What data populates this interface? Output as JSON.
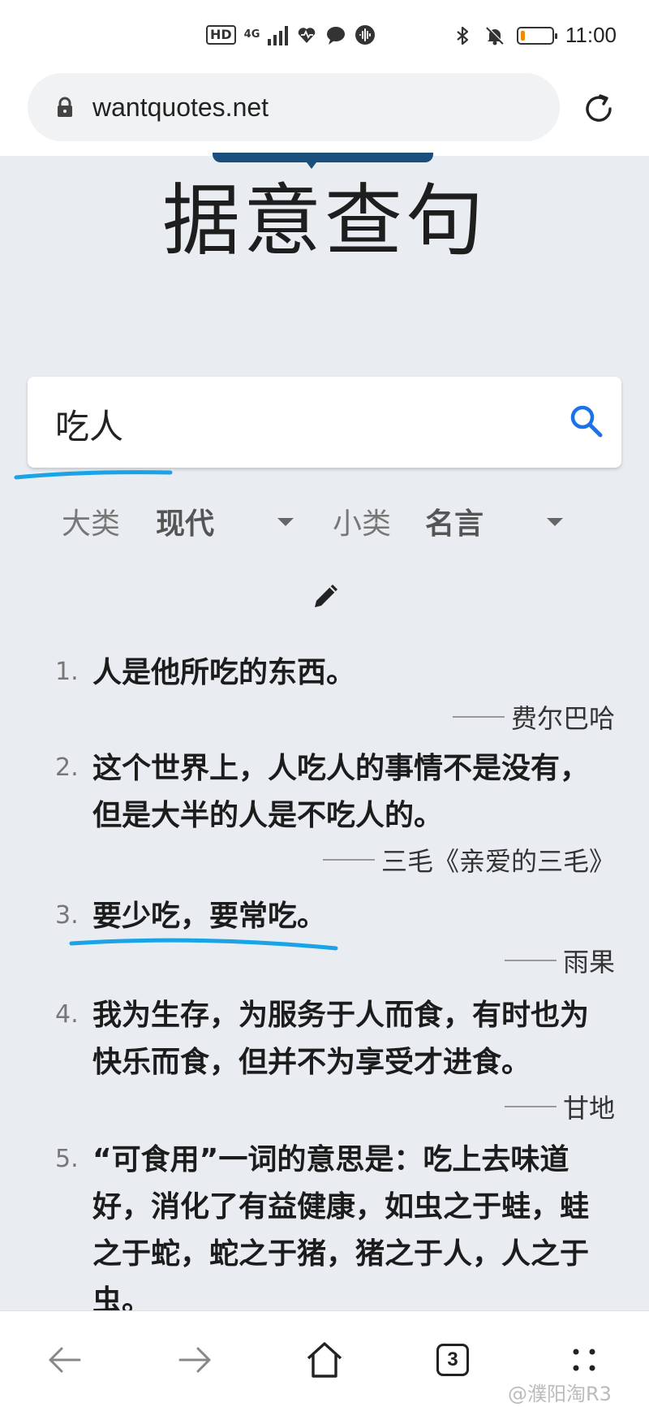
{
  "status_bar": {
    "hd": "HD",
    "network": "4G",
    "time": "11:00",
    "battery_level_percent": 15,
    "battery_color": "#f08a00"
  },
  "browser": {
    "url": "wantquotes.net",
    "open_tabs": "3"
  },
  "page": {
    "title": "据意查句",
    "search": {
      "value": "吃人"
    },
    "filters": {
      "major_label": "大类",
      "major_value": "现代",
      "minor_label": "小类",
      "minor_value": "名言"
    },
    "quotes": [
      {
        "num": "1.",
        "lines": [
          "人是他所吃的东西。"
        ],
        "source": "费尔巴哈"
      },
      {
        "num": "2.",
        "lines": [
          "这个世界上，人吃人的事情不是没有，",
          "但是大半的人是不吃人的。"
        ],
        "source": "三毛《亲爱的三毛》"
      },
      {
        "num": "3.",
        "lines": [
          "要少吃，要常吃。"
        ],
        "source": "雨果"
      },
      {
        "num": "4.",
        "lines": [
          "我为生存，为服务于人而食，有时也为",
          "快乐而食，但并不为享受才进食。"
        ],
        "source": "甘地"
      },
      {
        "num": "5.",
        "lines": [
          "“可食用”一词的意思是：吃上去味道",
          "好，消化了有益健康，如虫之于蛙，蛙",
          "之于蛇，蛇之于猪，猪之于人，人之于",
          "虫。"
        ],
        "source": ""
      }
    ]
  },
  "annotation_color": "#1aa3e6",
  "watermark": "@濮阳淘R3"
}
